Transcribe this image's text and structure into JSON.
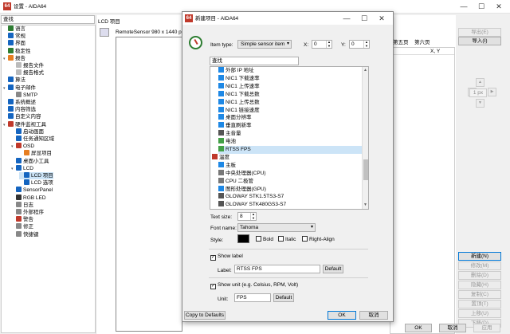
{
  "window": {
    "title": "设置 - AIDA64"
  },
  "search": {
    "placeholder": "查找"
  },
  "tree": [
    {
      "label": "语言",
      "color": "#2e7d32"
    },
    {
      "label": "常规",
      "color": "#1565c0"
    },
    {
      "label": "界面",
      "color": "#1565c0"
    },
    {
      "label": "稳定性",
      "color": "#2e7d32"
    },
    {
      "label": "报告",
      "color": "#e67e22"
    },
    {
      "label": "报告文件",
      "color": "#bbbbbb"
    },
    {
      "label": "报告格式",
      "color": "#bbbbbb"
    },
    {
      "label": "算法",
      "color": "#1565c0"
    },
    {
      "label": "电子邮件",
      "color": "#1565c0"
    },
    {
      "label": "SMTP",
      "color": "#888888"
    },
    {
      "label": "系统概述",
      "color": "#1565c0"
    },
    {
      "label": "内容筛选",
      "color": "#1565c0"
    },
    {
      "label": "自定义内容",
      "color": "#1565c0"
    },
    {
      "label": "硬件监视工具",
      "color": "#c0392b"
    },
    {
      "label": "启动画面",
      "color": "#1565c0"
    },
    {
      "label": "任务通知区域",
      "color": "#1565c0"
    },
    {
      "label": "OSD",
      "color": "#c0392b"
    },
    {
      "label": "屏显项目",
      "color": "#e67e22"
    },
    {
      "label": "桌面小工具",
      "color": "#1565c0"
    },
    {
      "label": "LCD",
      "color": "#1565c0"
    },
    {
      "label": "LCD 项目",
      "color": "#1565c0"
    },
    {
      "label": "LCD 选项",
      "color": "#1565c0"
    },
    {
      "label": "SensorPanel",
      "color": "#1565c0"
    },
    {
      "label": "RGB LED",
      "color": "#333333"
    },
    {
      "label": "日志",
      "color": "#888888"
    },
    {
      "label": "外部程序",
      "color": "#888888"
    },
    {
      "label": "警告",
      "color": "#c0392b"
    },
    {
      "label": "修正",
      "color": "#888888"
    },
    {
      "label": "快捷键",
      "color": "#888888"
    }
  ],
  "right_panel": {
    "section_title": "LCD 项目",
    "device": "RemoteSensor 980 x 1440 pixe",
    "page_tabs": [
      "第五页",
      "第六页"
    ],
    "column_header": "X, Y",
    "top_buttons": [
      "导出(E)",
      "导入(I)"
    ],
    "zoom": "1 px",
    "side_buttons": [
      "新建(N)",
      "修改(M)",
      "删除(D)",
      "隐藏(H)",
      "复制(C)",
      "置顶(T)",
      "上移(U)",
      "下移(D)"
    ],
    "bottom_buttons": [
      "OK",
      "取消",
      "应用"
    ]
  },
  "dialog": {
    "title": "新建项目 - AIDA64",
    "item_type_label": "Item type:",
    "item_type_value": "Simple sensor item",
    "x_label": "X:",
    "x_value": "0",
    "y_label": "Y:",
    "y_value": "0",
    "search_placeholder": "查找",
    "list_items": [
      {
        "label": "外部 IP 地址",
        "color": "#1e88e5"
      },
      {
        "label": "NIC1 下载速率",
        "color": "#1e88e5"
      },
      {
        "label": "NIC1 上传速率",
        "color": "#1e88e5"
      },
      {
        "label": "NIC1 下载总数",
        "color": "#1e88e5"
      },
      {
        "label": "NIC1 上传总数",
        "color": "#1e88e5"
      },
      {
        "label": "NIC1 链接速度",
        "color": "#1e88e5"
      },
      {
        "label": "桌面分辨率",
        "color": "#1e88e5"
      },
      {
        "label": "垂直刷新率",
        "color": "#1e88e5"
      },
      {
        "label": "主音量",
        "color": "#555555"
      },
      {
        "label": "电池",
        "color": "#43a047"
      },
      {
        "label": "RTSS FPS",
        "color": "#43a047",
        "selected": true
      },
      {
        "label": "温度",
        "color": "#c0392b",
        "top": true
      },
      {
        "label": "主板",
        "color": "#1e88e5"
      },
      {
        "label": "中央处理器(CPU)",
        "color": "#777777"
      },
      {
        "label": "CPU 二极管",
        "color": "#777777"
      },
      {
        "label": "图形处理器(GPU)",
        "color": "#1e88e5"
      },
      {
        "label": "GLOWAY STK1.5TS3-S7",
        "color": "#555555"
      },
      {
        "label": "GLOWAY STK480GS3-S7",
        "color": "#555555"
      }
    ],
    "text_size_label": "Text size:",
    "text_size_value": "8",
    "font_name_label": "Font name:",
    "font_name_value": "Tahoma",
    "style_label": "Style:",
    "text_color": "#000000",
    "bold_label": "Bold",
    "italic_label": "Italic",
    "right_align_label": "Right-Align",
    "show_label_label": "Show label",
    "label_label": "Label:",
    "label_value": "RTSS FPS",
    "default_label": "Default",
    "show_unit_label": "Show unit (e.g. Celsius, RPM, Volt)",
    "unit_label": "Unit:",
    "unit_value": "FPS",
    "copy_defaults": "Copy to Defaults",
    "ok": "OK",
    "cancel": "取消"
  },
  "icons": {
    "gauge": "gauge-icon",
    "device": "monitor-icon"
  }
}
